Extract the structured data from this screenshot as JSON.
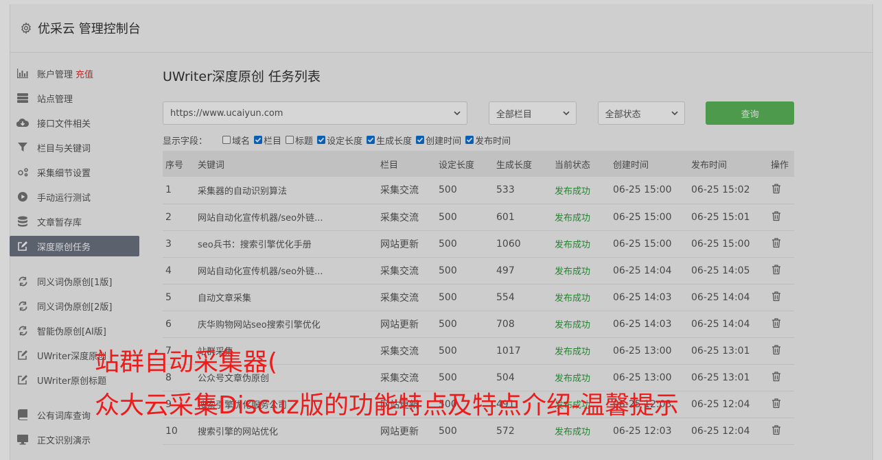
{
  "header": {
    "title": "优采云 管理控制台"
  },
  "sidebar": {
    "recharge": "充值",
    "group1": [
      {
        "label": "账户管理",
        "icon": "bar-chart-icon"
      },
      {
        "label": "站点管理",
        "icon": "server-icon"
      },
      {
        "label": "接口文件相关",
        "icon": "cloud-download-icon"
      },
      {
        "label": "栏目与关键词",
        "icon": "filter-icon"
      },
      {
        "label": "采集细节设置",
        "icon": "gears-icon"
      },
      {
        "label": "手动运行测试",
        "icon": "play-circle-icon"
      },
      {
        "label": "文章暂存库",
        "icon": "database-icon"
      },
      {
        "label": "深度原创任务",
        "icon": "edit-icon",
        "active": true
      }
    ],
    "group2": [
      {
        "label": "同义词伪原创[1版]",
        "icon": "refresh-icon"
      },
      {
        "label": "同义词伪原创[2版]",
        "icon": "refresh-icon"
      },
      {
        "label": "智能伪原创[AI版]",
        "icon": "refresh-icon"
      },
      {
        "label": "UWriter深度原创",
        "icon": "edit-icon"
      },
      {
        "label": "UWriter原创标题",
        "icon": "edit-icon"
      }
    ],
    "group3": [
      {
        "label": "公有词库查询",
        "icon": "book-icon"
      },
      {
        "label": "正文识别演示",
        "icon": "monitor-icon"
      }
    ]
  },
  "main": {
    "title": "UWriter深度原创 任务列表",
    "site_select": "https://www.ucaiyun.com",
    "column_select": "全部栏目",
    "status_select": "全部状态",
    "query_button": "查询",
    "fields_label": "显示字段：",
    "fields": [
      {
        "label": "域名",
        "checked": false
      },
      {
        "label": "栏目",
        "checked": true
      },
      {
        "label": "标题",
        "checked": false
      },
      {
        "label": "设定长度",
        "checked": true
      },
      {
        "label": "生成长度",
        "checked": true
      },
      {
        "label": "创建时间",
        "checked": true
      },
      {
        "label": "发布时间",
        "checked": true
      }
    ],
    "table": {
      "headers": [
        "序号",
        "关键词",
        "栏目",
        "设定长度",
        "生成长度",
        "当前状态",
        "创建时间",
        "发布时间",
        "操作"
      ],
      "rows": [
        [
          "1",
          "采集器的自动识别算法",
          "采集交流",
          "500",
          "533",
          "发布成功",
          "06-25 15:00",
          "06-25 15:02"
        ],
        [
          "2",
          "网站自动化宣传机器/seo外链...",
          "采集交流",
          "500",
          "601",
          "发布成功",
          "06-25 15:00",
          "06-25 15:01"
        ],
        [
          "3",
          "seo兵书：搜索引擎优化手册",
          "网站更新",
          "500",
          "1060",
          "发布成功",
          "06-25 15:00",
          "06-25 15:00"
        ],
        [
          "4",
          "网站自动化宣传机器/seo外链...",
          "采集交流",
          "500",
          "497",
          "发布成功",
          "06-25 14:04",
          "06-25 14:05"
        ],
        [
          "5",
          "自动文章采集",
          "采集交流",
          "500",
          "554",
          "发布成功",
          "06-25 14:03",
          "06-25 14:04"
        ],
        [
          "6",
          "庆华购物网站seo搜索引擎优化",
          "网站更新",
          "500",
          "708",
          "发布成功",
          "06-25 14:03",
          "06-25 14:04"
        ],
        [
          "7",
          "站群采集",
          "采集交流",
          "500",
          "1017",
          "发布成功",
          "06-25 13:00",
          "06-25 13:01"
        ],
        [
          "8",
          "公众号文章伪原创",
          "采集交流",
          "500",
          "504",
          "发布成功",
          "06-25 13:00",
          "06-25 13:01"
        ],
        [
          "9",
          "搜索引擎优化服务公司",
          "网站更新",
          "500",
          "491",
          "发布成功",
          "06-25 12:03",
          "06-25 12:04"
        ],
        [
          "10",
          "搜索引擎的网站优化",
          "网站更新",
          "500",
          "572",
          "发布成功",
          "06-25 12:03",
          "06-25 12:04"
        ]
      ]
    }
  },
  "watermark": {
    "line1": "站群自动采集器(",
    "line2": "众大云采集Discuz版的功能特点及特点介绍-温馨提示"
  }
}
